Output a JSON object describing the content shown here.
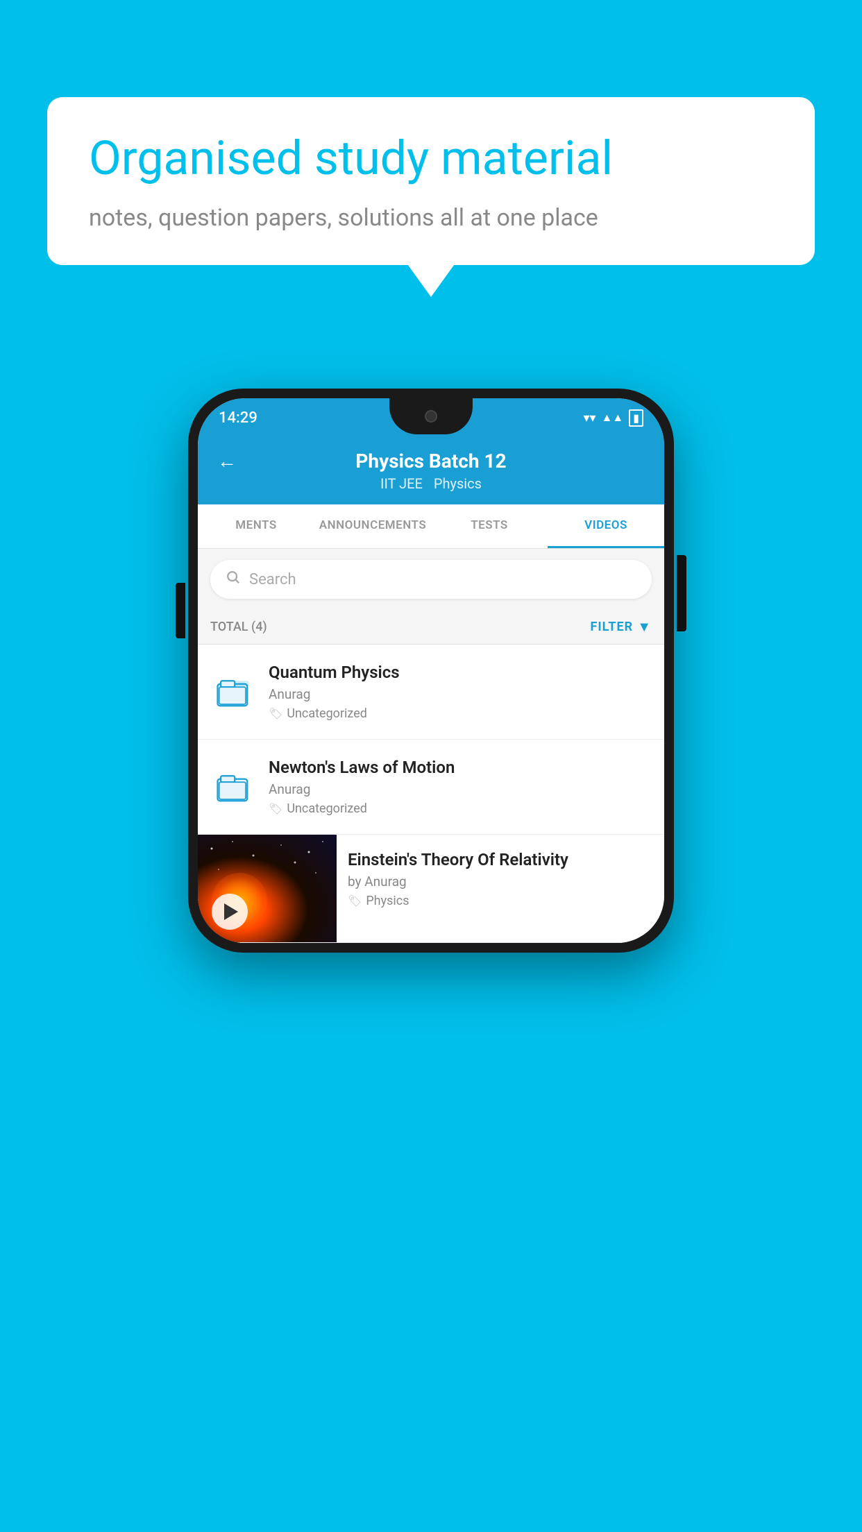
{
  "background_color": "#00BFEA",
  "speech_bubble": {
    "title": "Organised study material",
    "subtitle": "notes, question papers, solutions all at one place"
  },
  "phone": {
    "status_bar": {
      "time": "14:29",
      "wifi_icon": "▼",
      "signal_icon": "▲",
      "battery_icon": "▮"
    },
    "header": {
      "title": "Physics Batch 12",
      "subtitle1": "IIT JEE",
      "subtitle2": "Physics",
      "back_label": "←"
    },
    "tabs": [
      {
        "label": "MENTS",
        "active": false
      },
      {
        "label": "ANNOUNCEMENTS",
        "active": false
      },
      {
        "label": "TESTS",
        "active": false
      },
      {
        "label": "VIDEOS",
        "active": true
      }
    ],
    "search": {
      "placeholder": "Search"
    },
    "filter_bar": {
      "total_label": "TOTAL (4)",
      "filter_label": "FILTER"
    },
    "videos": [
      {
        "id": "quantum",
        "title": "Quantum Physics",
        "author": "Anurag",
        "tag": "Uncategorized",
        "has_thumb": false
      },
      {
        "id": "newton",
        "title": "Newton's Laws of Motion",
        "author": "Anurag",
        "tag": "Uncategorized",
        "has_thumb": false
      },
      {
        "id": "einstein",
        "title": "Einstein's Theory Of Relativity",
        "author": "by Anurag",
        "tag": "Physics",
        "has_thumb": true
      }
    ]
  }
}
